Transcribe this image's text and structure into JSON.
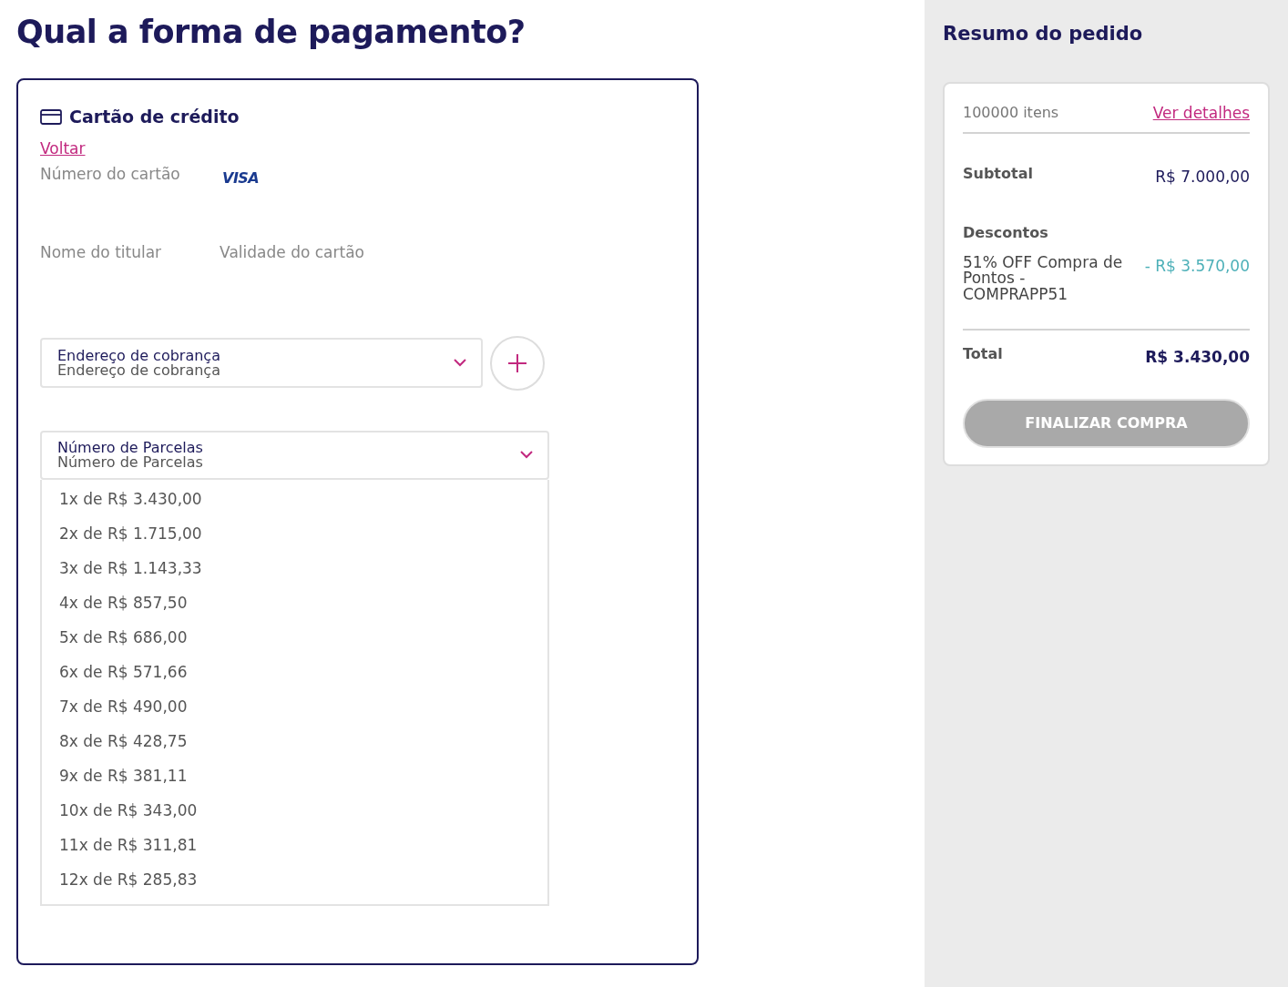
{
  "page_title": "Qual a forma de pagamento?",
  "payment": {
    "title": "Cartão de crédito",
    "back_link": "Voltar",
    "card_number": {
      "label": "Número do cartão",
      "brand": "VISA"
    },
    "holder": {
      "label": "Nome do titular"
    },
    "expiry": {
      "label": "Validade do cartão"
    },
    "billing_address": {
      "label": "Endereço de cobrança",
      "placeholder": "Endereço de cobrança"
    },
    "installments": {
      "label": "Número de Parcelas",
      "placeholder": "Número de Parcelas",
      "expanded": true,
      "options": [
        "1x de R$ 3.430,00",
        "2x de R$ 1.715,00",
        "3x de R$ 1.143,33",
        "4x de R$ 857,50",
        "5x de R$ 686,00",
        "6x de R$ 571,66",
        "7x de R$ 490,00",
        "8x de R$ 428,75",
        "9x de R$ 381,11",
        "10x de R$ 343,00",
        "11x de R$ 311,81",
        "12x de R$ 285,83"
      ]
    }
  },
  "summary": {
    "title": "Resumo do pedido",
    "items_count": "100000 itens",
    "details_link": "Ver detalhes",
    "subtotal_label": "Subtotal",
    "subtotal": "R$ 7.000,00",
    "discounts_label": "Descontos",
    "discounts": [
      {
        "name": "51% OFF Compra de Pontos - COMPRAPP51",
        "amount": "- R$ 3.570,00"
      }
    ],
    "total_label": "Total",
    "total": "R$ 3.430,00",
    "button": {
      "label": "FINALIZAR COMPRA",
      "disabled": true
    }
  }
}
